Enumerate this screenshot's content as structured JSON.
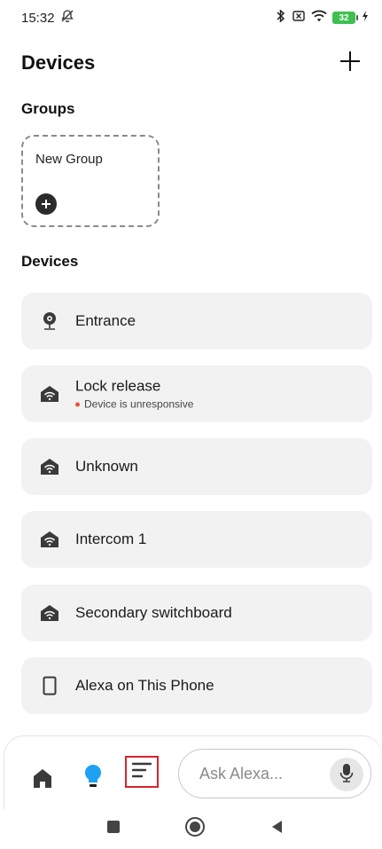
{
  "status_bar": {
    "time": "15:32",
    "battery_level": "32",
    "icons": [
      "alarm-off-icon",
      "bluetooth-icon",
      "no-sim-icon",
      "wifi-icon",
      "battery-icon",
      "charging-icon"
    ]
  },
  "header": {
    "title": "Devices",
    "add_icon": "plus-icon"
  },
  "groups": {
    "section_title": "Groups",
    "new_group_label": "New Group"
  },
  "devices": {
    "section_title": "Devices",
    "items": [
      {
        "name": "Entrance",
        "status": "",
        "icon": "camera-icon"
      },
      {
        "name": "Lock release",
        "status": "Device is unresponsive",
        "icon": "smart-home-icon"
      },
      {
        "name": "Unknown",
        "status": "",
        "icon": "smart-home-icon"
      },
      {
        "name": "Intercom 1",
        "status": "",
        "icon": "smart-home-icon"
      },
      {
        "name": "Secondary switchboard",
        "status": "",
        "icon": "smart-home-icon"
      },
      {
        "name": "Alexa on This Phone",
        "status": "",
        "icon": "phone-icon"
      }
    ]
  },
  "bottom_nav": {
    "ask_placeholder": "Ask Alexa...",
    "icons": [
      "home-icon",
      "lightbulb-icon",
      "menu-icon",
      "microphone-icon"
    ],
    "active_color": "#1da1f2",
    "highlight_color": "#d9232e"
  },
  "system_nav": {
    "icons": [
      "recents-icon",
      "home-circle-icon",
      "back-icon"
    ]
  }
}
